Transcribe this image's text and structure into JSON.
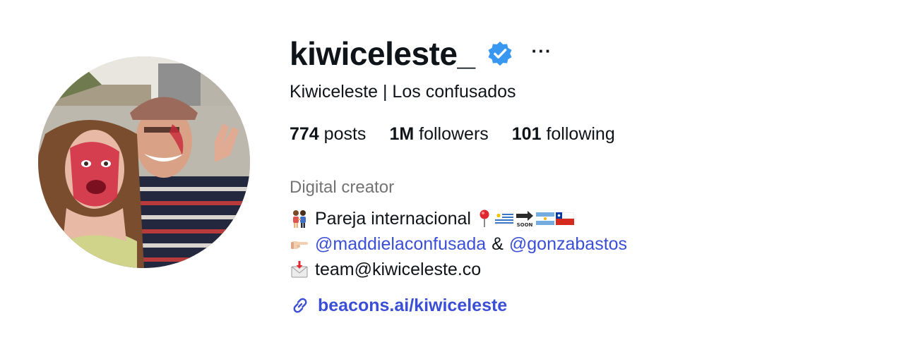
{
  "profile": {
    "username": "kiwiceleste_",
    "verified": true,
    "more_label": "···",
    "full_name": "Kiwiceleste | Los confusados",
    "stats": {
      "posts_count": "774",
      "posts_label": "posts",
      "followers_count": "1M",
      "followers_label": "followers",
      "following_count": "101",
      "following_label": "following"
    },
    "category": "Digital creator",
    "bio": {
      "line1_text": "Pareja internacional",
      "line1_icons": [
        "couple-icon",
        "pin-icon",
        "uruguay-flag-icon",
        "soon-arrow-icon",
        "argentina-flag-icon",
        "chile-flag-icon"
      ],
      "line2_icon": "pointing-hand-icon",
      "mention1": "@maddielaconfusada",
      "amp": "&",
      "mention2": "@gonzabastos",
      "line3_icon": "envelope-icon",
      "email": "team@kiwiceleste.co"
    },
    "link": {
      "icon": "link-icon",
      "text": "beacons.ai/kiwiceleste"
    }
  },
  "colors": {
    "text": "#0f1419",
    "secondary": "#737373",
    "link": "#3b4fd6",
    "verified_badge": "#3897f0"
  }
}
